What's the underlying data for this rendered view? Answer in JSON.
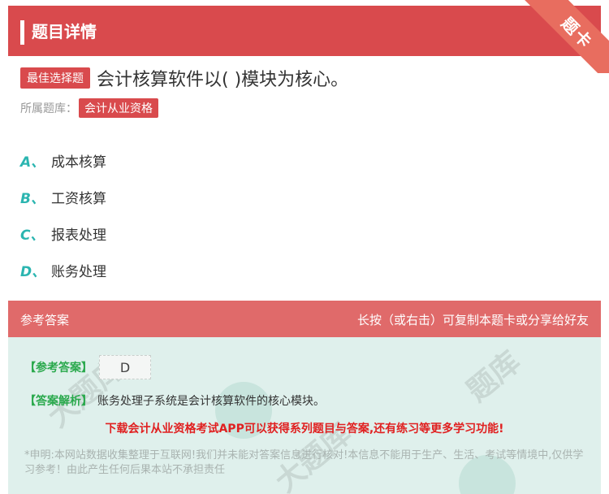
{
  "header": {
    "title": "题目详情",
    "corner_badge": "题卡"
  },
  "question": {
    "type_tag": "最佳选择题",
    "text": "会计核算软件以( )模块为核心。",
    "source_label": "所属题库：",
    "source_tag": "会计从业资格"
  },
  "options": [
    {
      "letter": "A、",
      "text": "成本核算"
    },
    {
      "letter": "B、",
      "text": "工资核算"
    },
    {
      "letter": "C、",
      "text": "报表处理"
    },
    {
      "letter": "D、",
      "text": "账务处理"
    }
  ],
  "answer_section": {
    "title": "参考答案",
    "hint": "长按（或右击）可复制本题卡或分享给好友",
    "answer_label": "【参考答案】",
    "answer_value": "D",
    "analysis_label": "【答案解析】",
    "analysis_text": "账务处理子系统是会计核算软件的核心模块。",
    "promo": "下载会计从业资格考试APP可以获得系列题目与答案,还有练习等更多学习功能!",
    "notice": "*申明:本网站数据收集整理于互联网!我们并未能对答案信息进行核对!本信息不能用于生产、生活、考试等情境中,仅供学习参考！由此产生任何后果本站不承担责任"
  },
  "colors": {
    "accent_red": "#d94a4d",
    "option_teal": "#2bb5b0",
    "answer_green": "#2aa94d",
    "answer_bg": "#dff0ec"
  }
}
